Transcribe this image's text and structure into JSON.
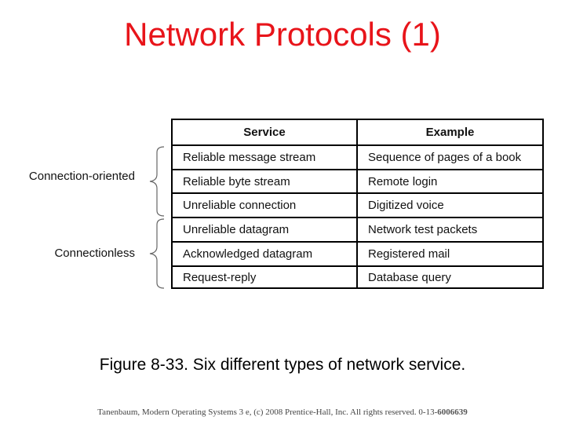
{
  "slide": {
    "title": "Network Protocols (1)",
    "caption": "Figure 8-33. Six different types of network service.",
    "footer_text": "Tanenbaum, Modern Operating Systems 3 e, (c) 2008 Prentice-Hall, Inc. All rights reserved. 0-13-",
    "footer_isbn_bold": "6006639"
  },
  "table": {
    "headers": [
      "Service",
      "Example"
    ],
    "rows": [
      {
        "service": "Reliable message stream",
        "example": "Sequence of pages of a book"
      },
      {
        "service": "Reliable byte stream",
        "example": "Remote login"
      },
      {
        "service": "Unreliable connection",
        "example": "Digitized voice"
      },
      {
        "service": "Unreliable datagram",
        "example": "Network test packets"
      },
      {
        "service": "Acknowledged datagram",
        "example": "Registered mail"
      },
      {
        "service": "Request-reply",
        "example": "Database query"
      }
    ]
  },
  "groups": [
    {
      "label": "Connection-oriented",
      "rows": [
        0,
        1,
        2
      ]
    },
    {
      "label": "Connectionless",
      "rows": [
        3,
        4,
        5
      ]
    }
  ],
  "colors": {
    "title": "#e8141a",
    "text": "#111111",
    "border": "#000000"
  }
}
